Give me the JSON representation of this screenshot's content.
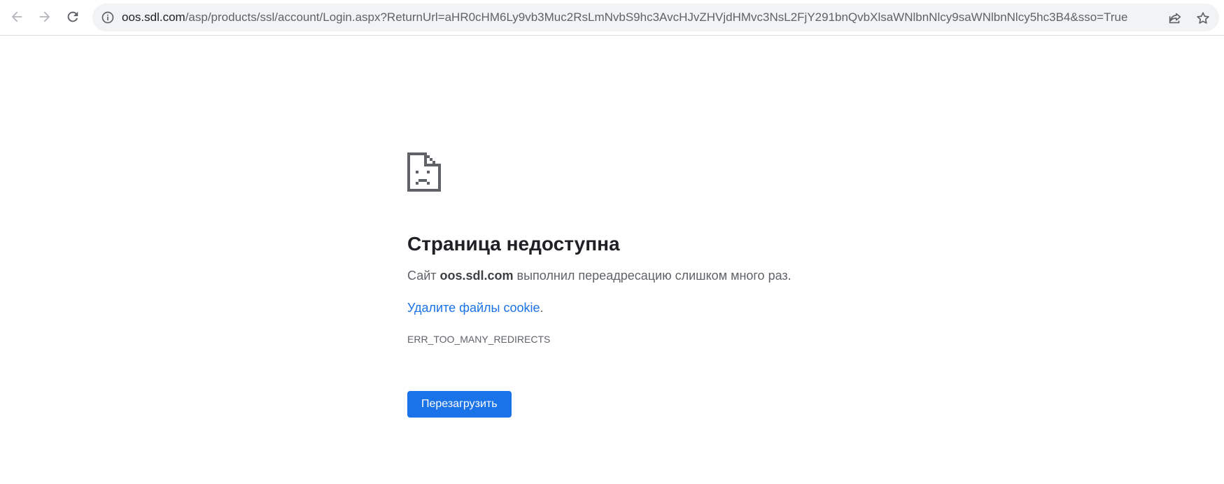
{
  "browser": {
    "url_host": "oos.sdl.com",
    "url_rest": "/asp/products/ssl/account/Login.aspx?ReturnUrl=aHR0cHM6Ly9vb3Muc2RsLmNvbS9hc3AvcHJvZHVjdHMvc3NsL2FjY291bnQvbXlsaWNlbnNlcy9saWNlbnNlcy5hc3B4&sso=True",
    "icons": {
      "back": "back-arrow-icon",
      "forward": "forward-arrow-icon",
      "reload": "reload-icon",
      "info": "info-icon",
      "share": "share-icon",
      "bookmark": "star-icon"
    }
  },
  "error_page": {
    "icon": "sad-page-icon",
    "title": "Страница недоступна",
    "desc_prefix": "Сайт ",
    "desc_host": "oos.sdl.com",
    "desc_suffix": " выполнил переадресацию слишком много раз.",
    "link_text": "Удалите файлы cookie",
    "link_suffix": ".",
    "error_code": "ERR_TOO_MANY_REDIRECTS",
    "reload_label": "Перезагрузить"
  },
  "colors": {
    "accent": "#1a73e8",
    "text_primary": "#202124",
    "text_secondary": "#5f6368"
  }
}
